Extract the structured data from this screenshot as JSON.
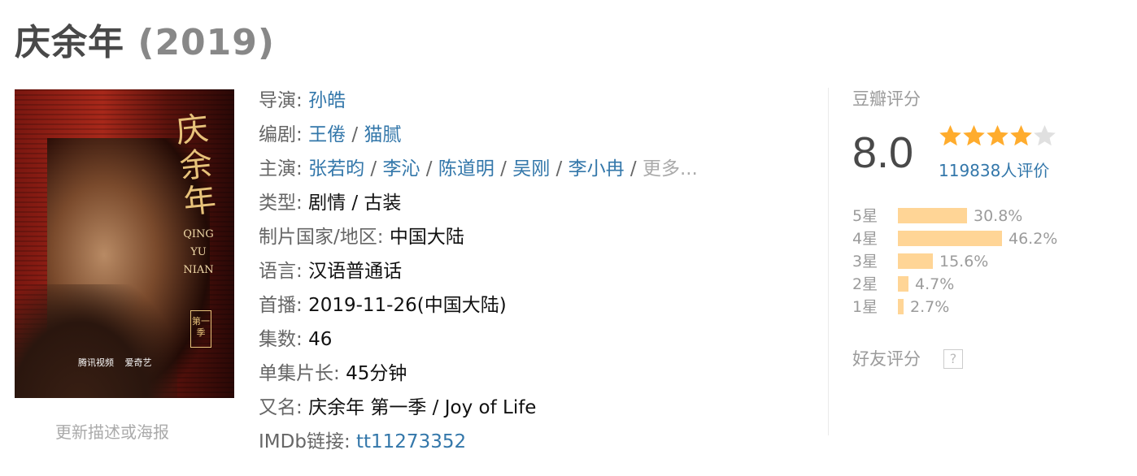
{
  "title": {
    "name": "庆余年",
    "year": "(2019)"
  },
  "poster": {
    "calligraphy": [
      "庆",
      "余",
      "年"
    ],
    "pinyin": [
      "QING",
      "YU",
      "NIAN"
    ],
    "season_tag": "第一季",
    "logos": [
      "腾讯视频",
      "爱奇艺"
    ]
  },
  "update_link": "更新描述或海报",
  "info": {
    "director": {
      "label": "导演",
      "values": [
        "孙皓"
      ]
    },
    "writer": {
      "label": "编剧",
      "values": [
        "王倦",
        "猫腻"
      ]
    },
    "cast": {
      "label": "主演",
      "values": [
        "张若昀",
        "李沁",
        "陈道明",
        "吴刚",
        "李小冉"
      ],
      "more": "更多..."
    },
    "genre": {
      "label": "类型",
      "value": "剧情 / 古装"
    },
    "country": {
      "label": "制片国家/地区",
      "value": "中国大陆"
    },
    "language": {
      "label": "语言",
      "value": "汉语普通话"
    },
    "premiere": {
      "label": "首播",
      "value": "2019-11-26(中国大陆)"
    },
    "episodes": {
      "label": "集数",
      "value": "46"
    },
    "runtime": {
      "label": "单集片长",
      "value": "45分钟"
    },
    "aka": {
      "label": "又名",
      "value": "庆余年 第一季 / Joy of Life"
    },
    "imdb": {
      "label": "IMDb链接",
      "value": "tt11273352"
    }
  },
  "rating": {
    "title": "豆瓣评分",
    "score": "8.0",
    "stars": 4,
    "count_text": "119838人评价",
    "breakdown": [
      {
        "label": "5星",
        "percent": 30.8,
        "text": "30.8%"
      },
      {
        "label": "4星",
        "percent": 46.2,
        "text": "46.2%"
      },
      {
        "label": "3星",
        "percent": 15.6,
        "text": "15.6%"
      },
      {
        "label": "2星",
        "percent": 4.7,
        "text": "4.7%"
      },
      {
        "label": "1星",
        "percent": 2.7,
        "text": "2.7%"
      }
    ],
    "friend_rating": "好友评分",
    "help_glyph": "?"
  },
  "colors": {
    "link": "#3377aa",
    "star_filled": "#ffac2d",
    "star_empty": "#e0e0e0",
    "bar": "#ffd596"
  }
}
